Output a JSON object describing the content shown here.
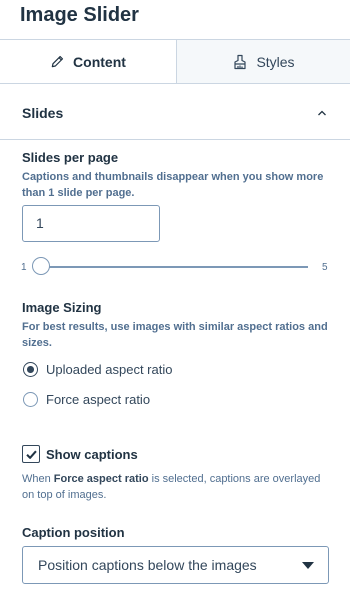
{
  "panel": {
    "title": "Image Slider"
  },
  "tabs": [
    {
      "label": "Content",
      "icon": "pencil-icon",
      "active": true
    },
    {
      "label": "Styles",
      "icon": "brush-icon",
      "active": false
    }
  ],
  "section": {
    "title": "Slides",
    "expanded": true
  },
  "slides_per_page": {
    "label": "Slides per page",
    "help": "Captions and thumbnails disappear when you show more than 1 slide per page.",
    "value": "1",
    "slider_min": "1",
    "slider_max": "5",
    "slider_value": 1
  },
  "image_sizing": {
    "label": "Image Sizing",
    "help": "For best results, use images with similar aspect ratios and sizes.",
    "options": [
      {
        "label": "Uploaded aspect ratio",
        "selected": true
      },
      {
        "label": "Force aspect ratio",
        "selected": false
      }
    ]
  },
  "show_captions": {
    "label": "Show captions",
    "checked": true,
    "note_prefix": "When ",
    "note_bold": "Force aspect ratio",
    "note_suffix": " is selected, captions are overlayed on top of images."
  },
  "caption_position": {
    "label": "Caption position",
    "selected": "Position captions below the images"
  }
}
